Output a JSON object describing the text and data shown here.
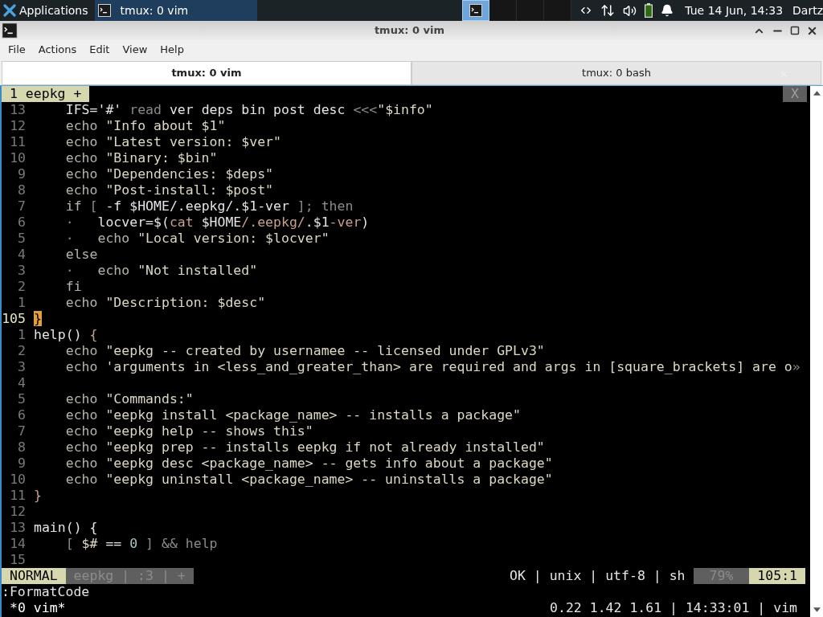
{
  "taskbar": {
    "apps_menu": "Applications",
    "tasks": [
      {
        "title": "tmux: 0 vim",
        "selected": true
      }
    ],
    "workspaces": [
      {
        "selected": true
      },
      {
        "selected": false
      },
      {
        "selected": false
      },
      {
        "selected": false
      }
    ],
    "clock": "Tue 14 Jun, 14:33",
    "user": "Dartz"
  },
  "window": {
    "title": "tmux: 0 vim",
    "menu": [
      "File",
      "Actions",
      "Edit",
      "View",
      "Help"
    ],
    "tabs": [
      {
        "label": "tmux: 0 vim",
        "selected": true
      },
      {
        "label": "tmux: 0 bash",
        "selected": false
      }
    ]
  },
  "tmux_top": {
    "window_label": "1 eepkg +",
    "close": "X"
  },
  "editor": {
    "lines": [
      {
        "number": "13",
        "current": false,
        "segments": [
          {
            "text": "    IFS='#' ",
            "kind": "plain"
          },
          {
            "text": "read",
            "kind": "dim"
          },
          {
            "text": " ver deps bin post desc ",
            "kind": "plain"
          },
          {
            "text": "<<<",
            "kind": "dim"
          },
          {
            "text": "\"$info\"",
            "kind": "string"
          }
        ]
      },
      {
        "number": "12",
        "current": false,
        "segments": [
          {
            "text": "    echo",
            "kind": "keyword"
          },
          {
            "text": " \"Info about $1\"",
            "kind": "string"
          }
        ]
      },
      {
        "number": "11",
        "current": false,
        "segments": [
          {
            "text": "    echo",
            "kind": "keyword"
          },
          {
            "text": " \"Latest version: $ver\"",
            "kind": "string"
          }
        ]
      },
      {
        "number": "10",
        "current": false,
        "segments": [
          {
            "text": "    echo",
            "kind": "keyword"
          },
          {
            "text": " \"Binary: $bin\"",
            "kind": "string"
          }
        ]
      },
      {
        "number": "9",
        "current": false,
        "segments": [
          {
            "text": "    echo",
            "kind": "keyword"
          },
          {
            "text": " \"Dependencies: $deps\"",
            "kind": "string"
          }
        ]
      },
      {
        "number": "8",
        "current": false,
        "segments": [
          {
            "text": "    echo",
            "kind": "keyword"
          },
          {
            "text": " \"Post-install: $post\"",
            "kind": "string"
          }
        ]
      },
      {
        "number": "7",
        "current": false,
        "segments": [
          {
            "text": "    if",
            "kind": "keyword"
          },
          {
            "text": " [ ",
            "kind": "dim"
          },
          {
            "text": "-f $HOME/.eepkg/.$1-ver",
            "kind": "plain"
          },
          {
            "text": " ]; then",
            "kind": "dim"
          }
        ]
      },
      {
        "number": "6",
        "current": false,
        "segments": [
          {
            "text": "    ·   ",
            "kind": "dim"
          },
          {
            "text": "locver=$(",
            "kind": "plain"
          },
          {
            "text": "cat",
            "kind": "red"
          },
          {
            "text": " $HOME",
            "kind": "plain"
          },
          {
            "text": "/.eepkg/",
            "kind": "red"
          },
          {
            "text": ".$1",
            "kind": "plain"
          },
          {
            "text": "-ver",
            "kind": "red"
          },
          {
            "text": ")",
            "kind": "plain"
          }
        ]
      },
      {
        "number": "5",
        "current": false,
        "segments": [
          {
            "text": "    ·   ",
            "kind": "dim"
          },
          {
            "text": "echo",
            "kind": "keyword"
          },
          {
            "text": " \"Local version: $locver\"",
            "kind": "string"
          }
        ]
      },
      {
        "number": "4",
        "current": false,
        "segments": [
          {
            "text": "    else",
            "kind": "keyword"
          }
        ]
      },
      {
        "number": "3",
        "current": false,
        "segments": [
          {
            "text": "    ·   ",
            "kind": "dim"
          },
          {
            "text": "echo",
            "kind": "keyword"
          },
          {
            "text": " \"Not installed\"",
            "kind": "string"
          }
        ]
      },
      {
        "number": "2",
        "current": false,
        "segments": [
          {
            "text": "    fi",
            "kind": "keyword"
          }
        ]
      },
      {
        "number": "1",
        "current": false,
        "segments": [
          {
            "text": "    echo",
            "kind": "keyword"
          },
          {
            "text": " \"Description: $desc\"",
            "kind": "string"
          }
        ]
      },
      {
        "number": "105",
        "current": true,
        "segments": [
          {
            "text": "}",
            "kind": "cursor"
          }
        ]
      },
      {
        "number": "1",
        "current": false,
        "segments": [
          {
            "text": "help() ",
            "kind": "plain"
          },
          {
            "text": "{",
            "kind": "red"
          }
        ]
      },
      {
        "number": "2",
        "current": false,
        "segments": [
          {
            "text": "    echo",
            "kind": "keyword"
          },
          {
            "text": " \"eepkg -- created by usernamee -- licensed under GPLv3\"",
            "kind": "string"
          }
        ]
      },
      {
        "number": "3",
        "current": false,
        "segments": [
          {
            "text": "    echo",
            "kind": "keyword"
          },
          {
            "text": " 'arguments in <less_and_greater_than> are required and args in [square_brackets] are o",
            "kind": "string"
          },
          {
            "text": "»",
            "kind": "dim"
          }
        ]
      },
      {
        "number": "4",
        "current": false
      },
      {
        "number": "5",
        "current": false,
        "segments": [
          {
            "text": "    echo",
            "kind": "keyword"
          },
          {
            "text": " \"Commands:\"",
            "kind": "string"
          }
        ]
      },
      {
        "number": "6",
        "current": false,
        "segments": [
          {
            "text": "    echo",
            "kind": "keyword"
          },
          {
            "text": " \"eepkg install <package_name> -- installs a package\"",
            "kind": "string"
          }
        ]
      },
      {
        "number": "7",
        "current": false,
        "segments": [
          {
            "text": "    echo",
            "kind": "keyword"
          },
          {
            "text": " \"eepkg help -- shows this\"",
            "kind": "string"
          }
        ]
      },
      {
        "number": "8",
        "current": false,
        "segments": [
          {
            "text": "    echo",
            "kind": "keyword"
          },
          {
            "text": " \"eepkg prep -- installs eepkg if not already installed\"",
            "kind": "string"
          }
        ]
      },
      {
        "number": "9",
        "current": false,
        "segments": [
          {
            "text": "    echo",
            "kind": "keyword"
          },
          {
            "text": " \"eepkg desc <package_name> -- gets info about a package\"",
            "kind": "string"
          }
        ]
      },
      {
        "number": "10",
        "current": false,
        "segments": [
          {
            "text": "    echo",
            "kind": "keyword"
          },
          {
            "text": " \"eepkg uninstall <package_name> -- uninstalls a package\"",
            "kind": "string"
          }
        ]
      },
      {
        "number": "11",
        "current": false,
        "segments": [
          {
            "text": "}",
            "kind": "red"
          }
        ]
      },
      {
        "number": "12",
        "current": false
      },
      {
        "number": "13",
        "current": false,
        "segments": [
          {
            "text": "main() {",
            "kind": "plain"
          }
        ]
      },
      {
        "number": "14",
        "current": false,
        "segments": [
          {
            "text": "    [ ",
            "kind": "dim"
          },
          {
            "text": "$#",
            "kind": "string"
          },
          {
            "text": " == ",
            "kind": "plain"
          },
          {
            "text": "0",
            "kind": "number"
          },
          {
            "text": " ] && help",
            "kind": "dim"
          }
        ]
      },
      {
        "number": "15",
        "current": false
      }
    ]
  },
  "vim_status": {
    "mode": "NORMAL",
    "file_info": "eepkg | :3 | +",
    "file_format": "OK | unix | utf-8 | sh",
    "percent": "79%",
    "position": "105:1"
  },
  "command_line": ":FormatCode",
  "tmux_status": {
    "windows": "*0 vim*",
    "info": "0.22 1.42 1.61 | 14:33:01 | vim"
  }
}
